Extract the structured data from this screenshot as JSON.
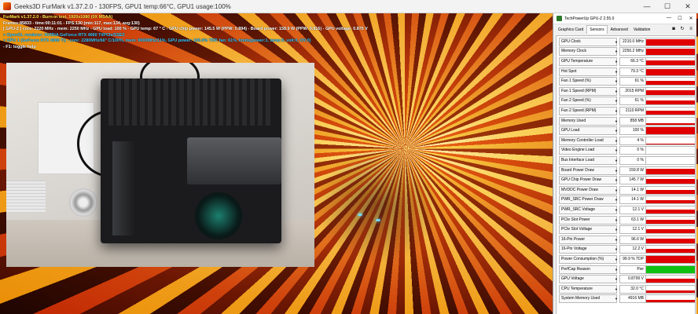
{
  "window": {
    "title": "Geeks3D FurMark v1.37.2.0 - 130FPS, GPU1 temp:66°C, GPU1 usage:100%",
    "controls": [
      "—",
      "☐",
      "✕"
    ]
  },
  "osd": {
    "lines": [
      {
        "text": "FurMark v1.37.2.0 - Burn-in test, 1920x1080 (0X MSAA)",
        "color": "#ffe84a"
      },
      {
        "text": "Frames:85833 - time:00:11:01 - FPS:130 (min:117, max:134, avg:130)",
        "color": "#ffffff"
      },
      {
        "text": "[ GPU-Z ] core: 2220 MHz - mem: 2250 MHz - GPU load: 100 % - GPU temp: 67 ° C - GPU chip power: 145.5 W (PPW: 0.894) - Board power: 158.9 W (PPW: 0.816) - GPU voltage: 0.875 V",
        "color": "#ffffff"
      },
      {
        "text": "> OpenGL renderer: NVIDIA GeForce RTX 4060 Ti/PCIe/SSE2",
        "color": "#35c8ff"
      },
      {
        "text": "> GPU 1 (GeForce RTX 4060 Ti) - core: 2280MHz/66° C/100%, mem: 9000MHz/11%, GPU power: 100.0% TDP, fan: 61%, limits(power:1, temp:0, volt:0, OV:0)",
        "color": "#35c8ff"
      },
      {
        "text": "- F1: toggle help",
        "color": "#ffffff"
      }
    ]
  },
  "gpuz": {
    "title": "TechPowerUp GPU-Z 2.55.0",
    "title_controls": [
      "—",
      "☐",
      "✕"
    ],
    "tabs": [
      "Graphics Card",
      "Sensors",
      "Advanced",
      "Validation"
    ],
    "active_tab": "Sensors",
    "toolbar_icons": [
      "camera-icon",
      "refresh-icon",
      "menu-icon"
    ],
    "sensors": [
      {
        "label": "GPU Clock",
        "value": "2210.0 MHz",
        "level": 0.9,
        "color": "#e00000"
      },
      {
        "label": "Memory Clock",
        "value": "2250.2 MHz",
        "level": 0.9,
        "color": "#e00000"
      },
      {
        "label": "GPU Temperature",
        "value": "66.3 °C",
        "level": 0.7,
        "color": "#e00000"
      },
      {
        "label": "Hot Spot",
        "value": "79.3 °C",
        "level": 0.8,
        "color": "#e00000"
      },
      {
        "label": "Fan 1 Speed (%)",
        "value": "61 %",
        "level": 0.6,
        "color": "#e00000"
      },
      {
        "label": "Fan 1 Speed (RPM)",
        "value": "2015 RPM",
        "level": 0.6,
        "color": "#e00000"
      },
      {
        "label": "Fan 2 Speed (%)",
        "value": "61 %",
        "level": 0.6,
        "color": "#e00000"
      },
      {
        "label": "Fan 2 Speed (RPM)",
        "value": "2110 RPM",
        "level": 0.6,
        "color": "#e00000"
      },
      {
        "label": "Memory Used",
        "value": "858 MB",
        "level": 0.15,
        "color": "#e00000"
      },
      {
        "label": "GPU Load",
        "value": "100 %",
        "level": 1.0,
        "color": "#e00000"
      },
      {
        "label": "Memory Controller Load",
        "value": "4 %",
        "level": 0.05,
        "color": "#e00000"
      },
      {
        "label": "Video Engine Load",
        "value": "0 %",
        "level": 0.0,
        "color": "#e00000"
      },
      {
        "label": "Bus Interface Load",
        "value": "0 %",
        "level": 0.0,
        "color": "#e00000"
      },
      {
        "label": "Board Power Draw",
        "value": "159.8 W",
        "level": 0.7,
        "color": "#e00000"
      },
      {
        "label": "GPU Chip Power Draw",
        "value": "145.7 W",
        "level": 0.7,
        "color": "#e00000"
      },
      {
        "label": "MVDDC Power Draw",
        "value": "14.1 W",
        "level": 0.5,
        "color": "#e00000"
      },
      {
        "label": "PWR_SRC Power Draw",
        "value": "14.1 W",
        "level": 0.5,
        "color": "#e00000"
      },
      {
        "label": "PWR_SRC Voltage",
        "value": "12.1 V",
        "level": 0.6,
        "color": "#e00000"
      },
      {
        "label": "PCIe Slot Power",
        "value": "63.1 W",
        "level": 0.55,
        "color": "#e00000"
      },
      {
        "label": "PCIe Slot Voltage",
        "value": "12.1 V",
        "level": 0.6,
        "color": "#e00000"
      },
      {
        "label": "16-Pin Power",
        "value": "96.6 W",
        "level": 0.6,
        "color": "#e00000"
      },
      {
        "label": "16-Pin Voltage",
        "value": "12.2 V",
        "level": 0.6,
        "color": "#e00000"
      },
      {
        "label": "Power Consumption (%)",
        "value": "99.9 % TDP",
        "level": 0.95,
        "color": "#e00000"
      },
      {
        "label": "PerfCap Reason",
        "value": "Pwr",
        "level": 1.0,
        "color": "#10c010"
      },
      {
        "label": "GPU Voltage",
        "value": "0.8700 V",
        "level": 0.6,
        "color": "#e00000"
      },
      {
        "label": "CPU Temperature",
        "value": "32.0 °C",
        "level": 0.3,
        "color": "#e00000"
      },
      {
        "label": "System Memory Used",
        "value": "4916 MB",
        "level": 0.35,
        "color": "#e00000"
      }
    ]
  }
}
